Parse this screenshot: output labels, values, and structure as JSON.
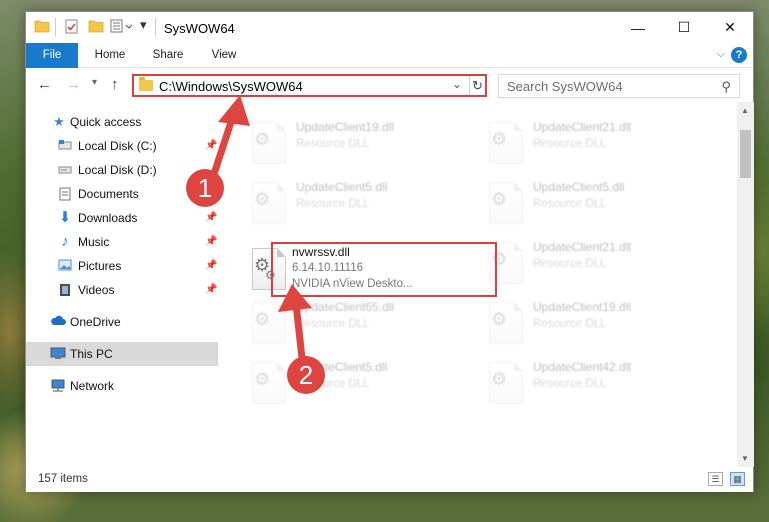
{
  "window": {
    "title": "SysWOW64",
    "controls": {
      "minimize": "—",
      "maximize": "☐",
      "close": "✕"
    }
  },
  "ribbon": {
    "tabs": [
      "File",
      "Home",
      "Share",
      "View"
    ],
    "help": "?"
  },
  "navigation": {
    "address": "C:\\Windows\\SysWOW64",
    "search_placeholder": "Search SysWOW64"
  },
  "sidebar": {
    "items": [
      {
        "label": "Quick access",
        "icon": "star-icon",
        "pinned": false
      },
      {
        "label": "Local Disk (C:)",
        "icon": "drive-icon",
        "pinned": true
      },
      {
        "label": "Local Disk (D:)",
        "icon": "drive-icon",
        "pinned": false
      },
      {
        "label": "Documents",
        "icon": "documents-icon",
        "pinned": true
      },
      {
        "label": "Downloads",
        "icon": "downloads-icon",
        "pinned": true
      },
      {
        "label": "Music",
        "icon": "music-icon",
        "pinned": true
      },
      {
        "label": "Pictures",
        "icon": "pictures-icon",
        "pinned": true
      },
      {
        "label": "Videos",
        "icon": "videos-icon",
        "pinned": true
      },
      {
        "label": "OneDrive",
        "icon": "cloud-icon",
        "pinned": false
      },
      {
        "label": "This PC",
        "icon": "computer-icon",
        "pinned": false,
        "selected": true
      },
      {
        "label": "Network",
        "icon": "network-icon",
        "pinned": false
      }
    ]
  },
  "files": {
    "left_column": [
      {
        "name": "UpdateClient19.dll",
        "type": "Resource DLL"
      },
      {
        "name": "UpdateClient5.dll",
        "type": "Resource DLL"
      },
      {
        "name": "nvwrssv.dll",
        "version": "6.14.10.11116",
        "description": "NVIDIA nView Deskto...",
        "highlighted": true
      },
      {
        "name": "UpdateClient65.dll",
        "type": "Resource DLL"
      },
      {
        "name": "UpdateClient5.dll",
        "type": "Resource DLL"
      }
    ],
    "right_column": [
      {
        "name": "UpdateClient21.dll",
        "type": "Resource DLL"
      },
      {
        "name": "UpdateClient5.dll",
        "type": "Resource DLL"
      },
      {
        "name": "UpdateClient21.dll",
        "type": "Resource DLL"
      },
      {
        "name": "UpdateClient19.dll",
        "type": "Resource DLL"
      },
      {
        "name": "UpdateClient42.dll",
        "type": "Resource DLL"
      }
    ]
  },
  "status": {
    "item_count": "157 items"
  },
  "annotations": {
    "step1": "1",
    "step2": "2",
    "color": "#de4540"
  }
}
